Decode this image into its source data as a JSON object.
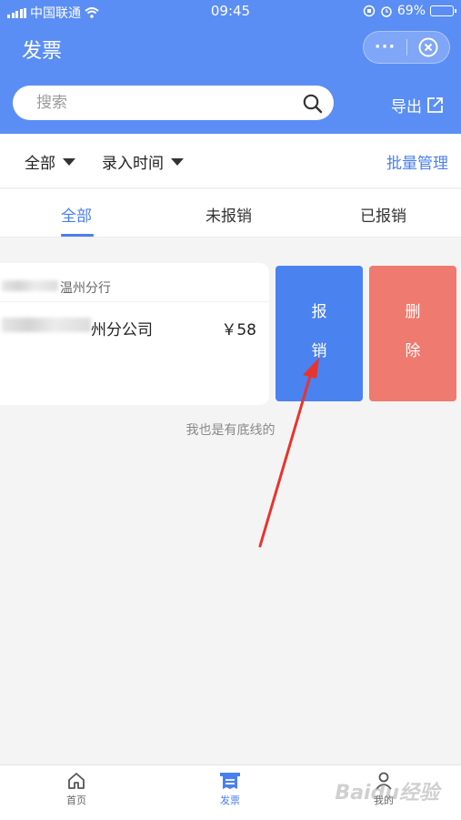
{
  "status_bar": {
    "carrier": "中国联通",
    "time": "09:45",
    "battery": "69%",
    "battery_level": 0.69
  },
  "header": {
    "title": "发票",
    "more_icon": "more-dots-icon",
    "close_icon": "close-circle-icon"
  },
  "search": {
    "placeholder": "搜索"
  },
  "export": {
    "label": "导出"
  },
  "filters": {
    "scope": "全部",
    "sort": "录入时间",
    "batch_manage": "批量管理"
  },
  "tabs": [
    {
      "label": "全部",
      "active": true
    },
    {
      "label": "未报销",
      "active": false
    },
    {
      "label": "已报销",
      "active": false
    }
  ],
  "invoice": {
    "bank": "温州分行",
    "company": "州分公司",
    "amount": "￥58"
  },
  "swipe_actions": {
    "reimburse": [
      "报",
      "销"
    ],
    "delete": [
      "删",
      "除"
    ]
  },
  "list_footer": "我也是有底线的",
  "tabbar": [
    {
      "label": "首页",
      "icon": "home-icon",
      "active": false
    },
    {
      "label": "发票",
      "icon": "invoice-icon",
      "active": true
    },
    {
      "label": "我的",
      "icon": "user-icon",
      "active": false
    }
  ],
  "watermark": "Baidu经验",
  "colors": {
    "primary": "#5b8ef5",
    "accent": "#4a7ff0",
    "delete": "#ef7a6f",
    "arrow": "#e8342c"
  }
}
